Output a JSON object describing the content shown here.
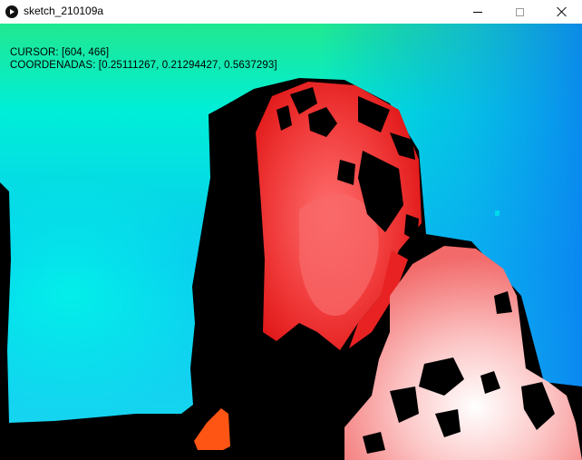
{
  "window": {
    "title": "sketch_210109a",
    "app_icon": "processing-play-icon",
    "controls": [
      "minimize-icon",
      "maximize-icon",
      "close-icon"
    ]
  },
  "overlay": {
    "cursor_text": "CURSOR: [604, 466]",
    "coords_text": "COORDENADAS: [0.25111267, 0.21294427, 0.5637293]"
  },
  "colors": {
    "background_top": "#1de895",
    "background_mid": "#00e8e0",
    "background_right": "#0a8ef0",
    "shadow": "#000000",
    "near_red": "#ee1c1c",
    "mid_pink": "#f87a7a",
    "far_white": "#ffffff",
    "orange_patch": "#ff5514"
  }
}
